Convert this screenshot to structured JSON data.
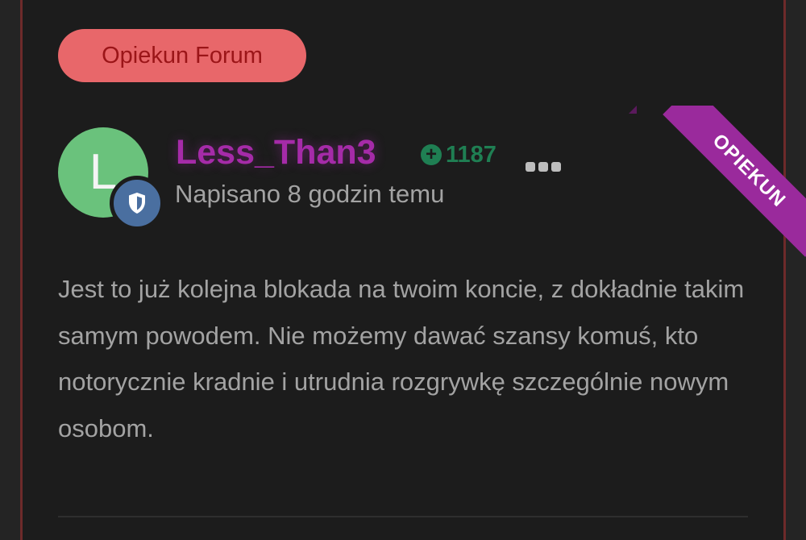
{
  "forum_badge": {
    "label": "Opiekun Forum"
  },
  "author": {
    "avatar_letter": "L",
    "username": "Less_Than3",
    "reputation": "1187",
    "role_ribbon": "OPIEKUN"
  },
  "post": {
    "time": "Napisano 8 godzin temu",
    "body": "Jest to już kolejna blokada na twoim koncie, z dokładnie takim samym powodem. Nie możemy dawać szansy komuś, kto notorycznie kradnie i utrudnia rozgrywkę szczególnie nowym osobom."
  },
  "colors": {
    "accent_purple": "#a52ba8",
    "badge_red": "#e8676a",
    "reputation_green": "#1f7f53",
    "avatar_green": "#6ac27c",
    "mod_badge_blue": "#4a6fa0"
  },
  "icons": {
    "reputation": "plus-circle-icon",
    "more": "ellipsis-icon",
    "moderator": "shield-icon"
  }
}
